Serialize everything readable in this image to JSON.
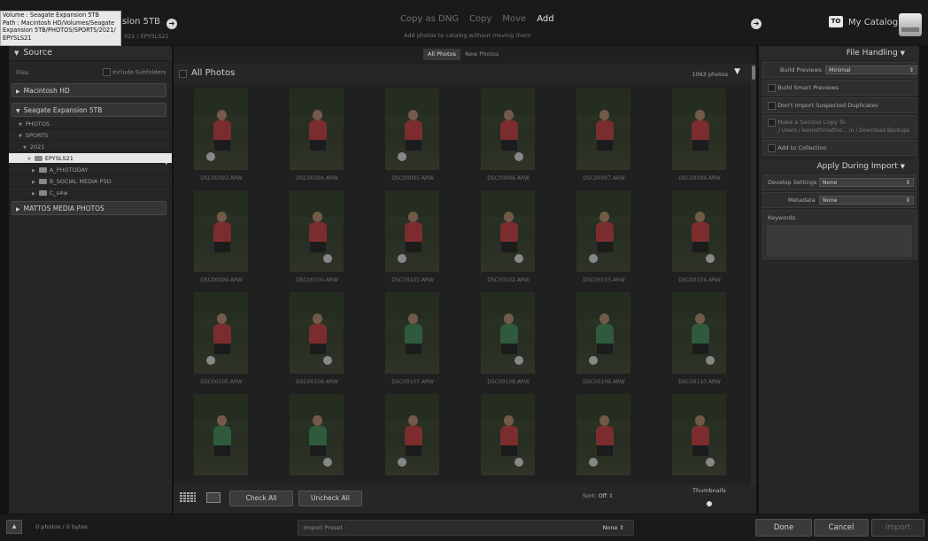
{
  "tooltip": {
    "volume": "Volume : Seagate Expansion 5TB",
    "path_lines": [
      "Path : Macintosh HD/Volumes/Seagate",
      "Expansion 5TB/PHOTOS/SPORTS/2021/",
      "EPYSLS21"
    ]
  },
  "topbar": {
    "source_name": "sion 5TB",
    "source_path": "021 / EPYSLS21",
    "forward_icon": "arrow-right-icon",
    "modes": [
      {
        "label": "Copy as DNG",
        "active": false
      },
      {
        "label": "Copy",
        "active": false
      },
      {
        "label": "Move",
        "active": false
      },
      {
        "label": "Add",
        "active": true
      }
    ],
    "mode_description": "Add photos to catalog without moving them",
    "catalog_badge": "TO",
    "catalog_name": "My Catalog"
  },
  "source_panel": {
    "title": "Source",
    "files_label": "Files",
    "include_subfolders": "Include Subfolders",
    "volumes": [
      "Macintosh HD",
      "Seagate Expansion 5TB",
      "MATTOS MEDIA PHOTOS"
    ],
    "tree": [
      {
        "label": "PHOTOS",
        "indent": 1
      },
      {
        "label": "SPORTS",
        "indent": 1
      },
      {
        "label": "2021",
        "indent": 2
      },
      {
        "label": "EPYSLS21",
        "indent": 3,
        "selected": true
      },
      {
        "label": "A_PHOTODAY",
        "indent": 4
      },
      {
        "label": "B_SOCIAL MEDIA PSD",
        "indent": 4
      },
      {
        "label": "C_s4w",
        "indent": 4
      }
    ]
  },
  "center": {
    "tabs": [
      "All Photos",
      "New Photos"
    ],
    "active_tab": "All Photos",
    "title": "All Photos",
    "count": "1063 photos",
    "photos": [
      {
        "name": "DSC00093.ARW",
        "jersey": "#c63a3a",
        "ball": true
      },
      {
        "name": "DSC00094.ARW",
        "jersey": "#c63a3a",
        "ball": false
      },
      {
        "name": "DSC00095.ARW",
        "jersey": "#c63a3a",
        "ball": true
      },
      {
        "name": "DSC00096.ARW",
        "jersey": "#c63a3a",
        "ball": true
      },
      {
        "name": "DSC00097.ARW",
        "jersey": "#c63a3a",
        "ball": false
      },
      {
        "name": "DSC00098.ARW",
        "jersey": "#c63a3a",
        "ball": false
      },
      {
        "name": "DSC00099.ARW",
        "jersey": "#c63a3a",
        "ball": false
      },
      {
        "name": "DSC00100.ARW",
        "jersey": "#c63a3a",
        "ball": true
      },
      {
        "name": "DSC00101.ARW",
        "jersey": "#c63a3a",
        "ball": true
      },
      {
        "name": "DSC00102.ARW",
        "jersey": "#c63a3a",
        "ball": true
      },
      {
        "name": "DSC00103.ARW",
        "jersey": "#c63a3a",
        "ball": true
      },
      {
        "name": "DSC00104.ARW",
        "jersey": "#c63a3a",
        "ball": true
      },
      {
        "name": "DSC00105.ARW",
        "jersey": "#c63a3a",
        "ball": true
      },
      {
        "name": "DSC00106.ARW",
        "jersey": "#c63a3a",
        "ball": true
      },
      {
        "name": "DSC00107.ARW",
        "jersey": "#3c8a55",
        "ball": false
      },
      {
        "name": "DSC00108.ARW",
        "jersey": "#3c8a55",
        "ball": true
      },
      {
        "name": "DSC00109.ARW",
        "jersey": "#3c8a55",
        "ball": true
      },
      {
        "name": "DSC00110.ARW",
        "jersey": "#3c8a55",
        "ball": true
      },
      {
        "name": "",
        "jersey": "#3c8a55",
        "ball": false
      },
      {
        "name": "",
        "jersey": "#3c8a55",
        "ball": true
      },
      {
        "name": "",
        "jersey": "#c63a3a",
        "ball": true
      },
      {
        "name": "",
        "jersey": "#c63a3a",
        "ball": true
      },
      {
        "name": "",
        "jersey": "#c63a3a",
        "ball": true
      },
      {
        "name": "",
        "jersey": "#c63a3a",
        "ball": true
      }
    ],
    "check_all": "Check All",
    "uncheck_all": "Uncheck All",
    "sort_label": "Sort:",
    "sort_value": "Off",
    "thumbnails_label": "Thumbnails"
  },
  "file_handling": {
    "title": "File Handling",
    "build_previews_label": "Build Previews",
    "build_previews_value": "Minimal",
    "build_smart_previews": "Build Smart Previews",
    "dont_import_duplicates": "Don't Import Suspected Duplicates",
    "second_copy": "Make a Second Copy To :",
    "second_copy_path": "/ Users / kennethmattos... m / Download Backups",
    "add_to_collection": "Add to Collection"
  },
  "apply_during_import": {
    "title": "Apply During Import",
    "develop_settings_label": "Develop Settings",
    "develop_settings_value": "None",
    "metadata_label": "Metadata",
    "metadata_value": "None",
    "keywords_label": "Keywords"
  },
  "footer": {
    "status": "0 photos / 0 bytes",
    "import_preset_label": "Import Preset :",
    "import_preset_value": "None",
    "done": "Done",
    "cancel": "Cancel",
    "import": "Import"
  }
}
